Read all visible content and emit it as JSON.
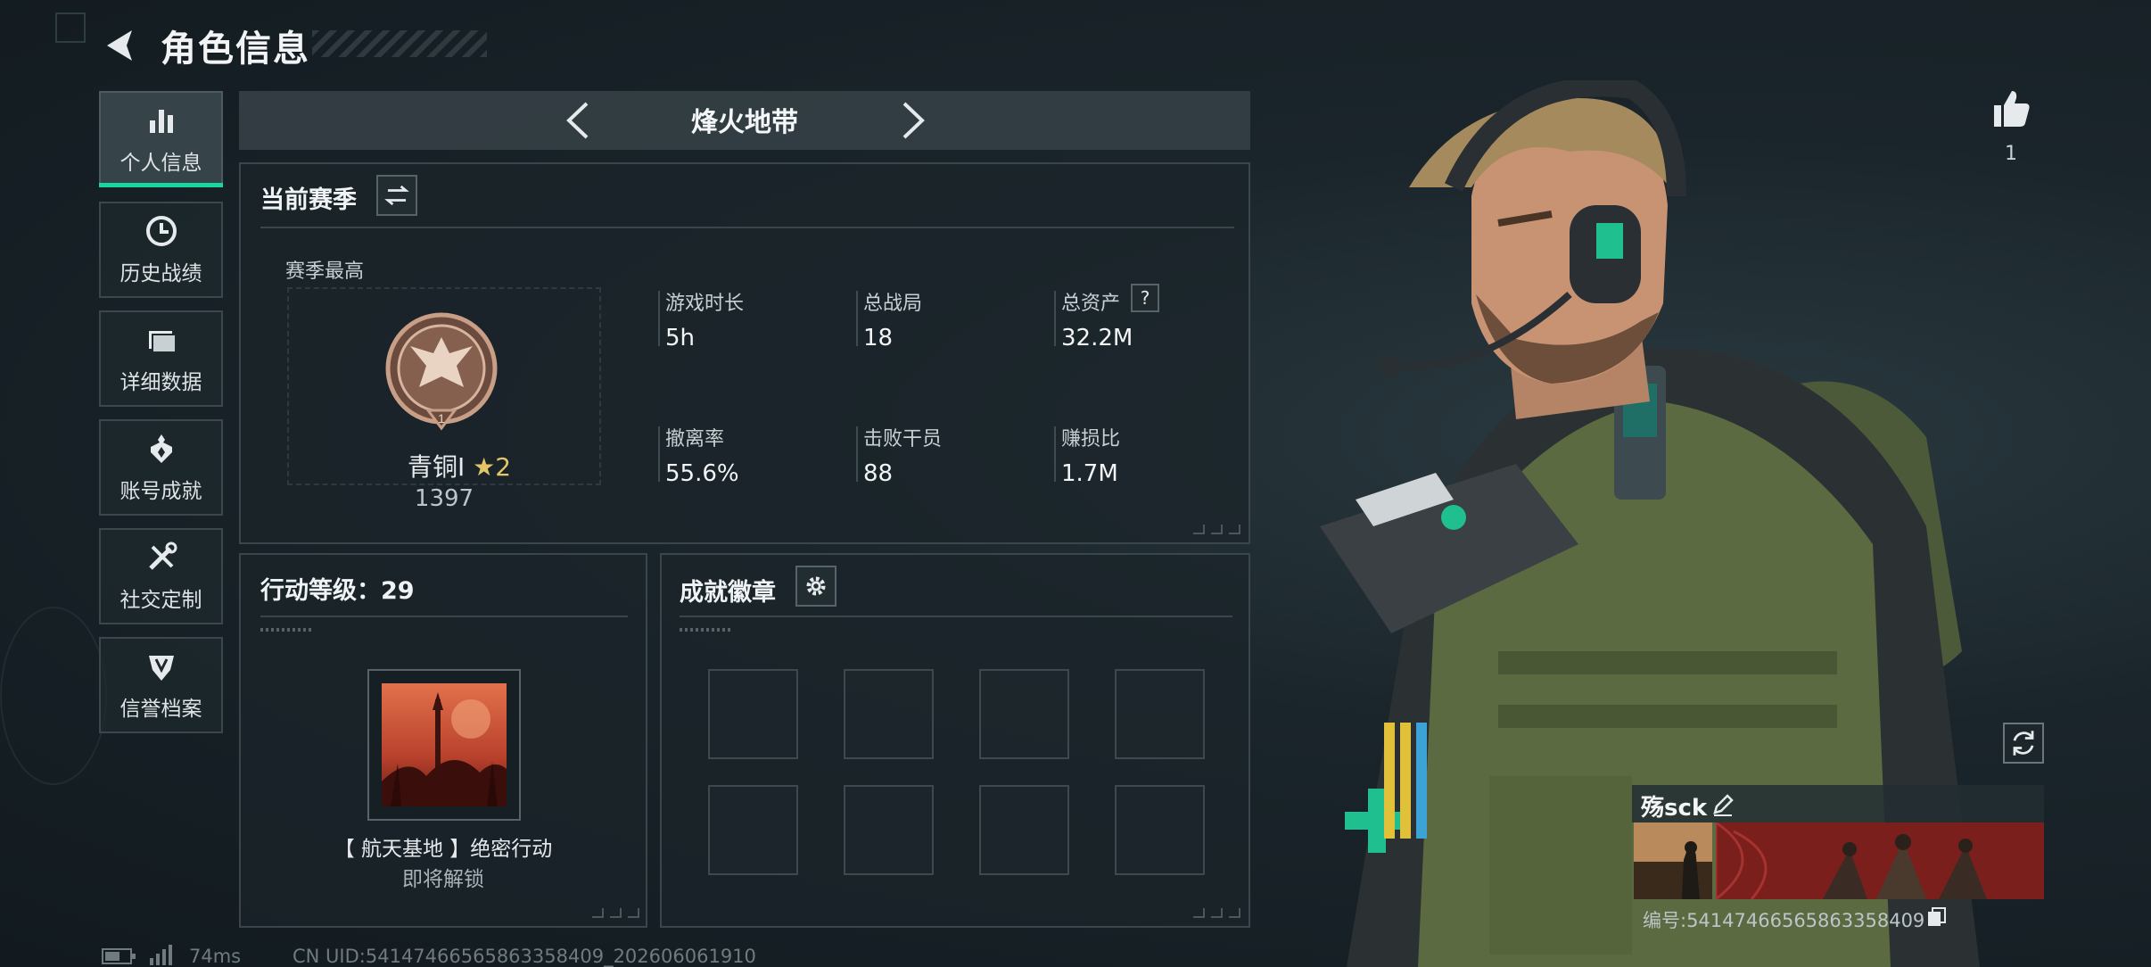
{
  "header": {
    "title": "角色信息"
  },
  "nav": {
    "items": [
      {
        "label": "个人信息",
        "icon": "bar-chart-icon"
      },
      {
        "label": "历史战绩",
        "icon": "history-clock-icon"
      },
      {
        "label": "详细数据",
        "icon": "folder-icon"
      },
      {
        "label": "账号成就",
        "icon": "medal-icon"
      },
      {
        "label": "社交定制",
        "icon": "tools-icon"
      },
      {
        "label": "信誉档案",
        "icon": "shield-icon"
      }
    ]
  },
  "mode": {
    "label": "烽火地带"
  },
  "season": {
    "title": "当前赛季",
    "highest_label": "赛季最高",
    "rank_name": "青铜Ⅰ",
    "rank_star": "★2",
    "rank_points": "1397",
    "stats": [
      {
        "label": "游戏时长",
        "value": "5h"
      },
      {
        "label": "总战局",
        "value": "18"
      },
      {
        "label": "总资产",
        "value": "32.2M",
        "help": "?"
      },
      {
        "label": "撤离率",
        "value": "55.6%"
      },
      {
        "label": "击败干员",
        "value": "88"
      },
      {
        "label": "赚损比",
        "value": "1.7M"
      }
    ]
  },
  "operation": {
    "title": "行动等级：29",
    "mission_name": "【 航天基地 】绝密行动",
    "mission_status": "即将解锁"
  },
  "badges": {
    "title": "成就徽章",
    "slots": 8
  },
  "profile": {
    "likes": "1",
    "name": "殇sck",
    "id_text": "编号:5414746656586335840​9"
  },
  "status": {
    "ping": "74ms",
    "uid": "CN UID:5414746656586335840​9_202606061910"
  },
  "colors": {
    "accent": "#19d6a1",
    "panel_border": "#3a464c",
    "background": "#1a252b"
  }
}
